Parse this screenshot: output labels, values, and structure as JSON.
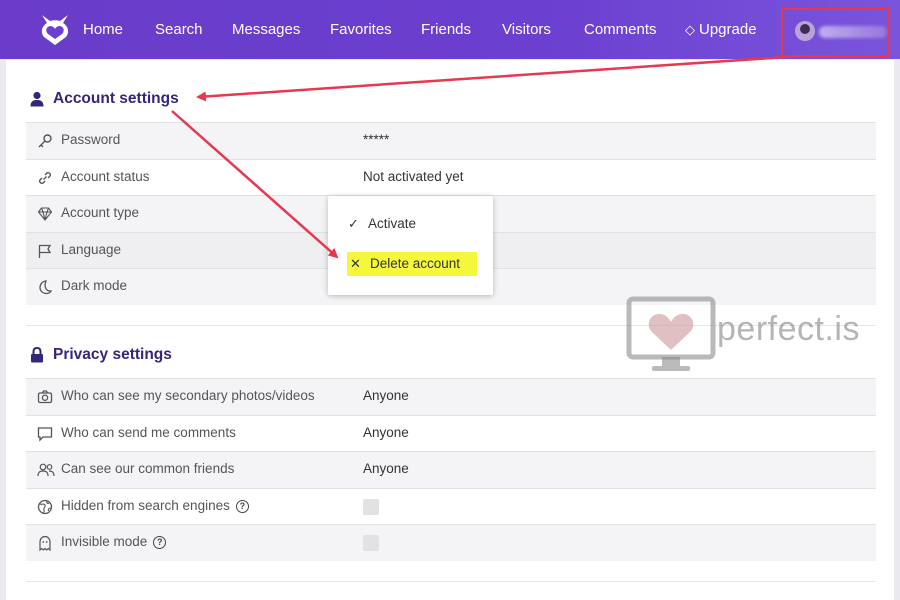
{
  "nav": {
    "items": [
      "Home",
      "Search",
      "Messages",
      "Favorites",
      "Friends",
      "Visitors",
      "Comments"
    ],
    "upgrade": "Upgrade"
  },
  "account": {
    "title": "Account settings",
    "rows": [
      {
        "label": "Password",
        "value": "*****",
        "icon": "key-icon"
      },
      {
        "label": "Account status",
        "value": "Not activated yet",
        "icon": "link-icon"
      },
      {
        "label": "Account type",
        "value": "",
        "icon": "diamond-icon"
      },
      {
        "label": "Language",
        "value": "",
        "icon": "flag-icon"
      },
      {
        "label": "Dark mode",
        "value": "",
        "icon": "moon-icon"
      }
    ]
  },
  "dropdown": {
    "activate": "Activate",
    "delete": "Delete account"
  },
  "privacy": {
    "title": "Privacy settings",
    "rows": [
      {
        "label": "Who can see my secondary photos/videos",
        "value": "Anyone",
        "icon": "camera-icon"
      },
      {
        "label": "Who can send me comments",
        "value": "Anyone",
        "icon": "comment-icon"
      },
      {
        "label": "Can see our common friends",
        "value": "Anyone",
        "icon": "users-icon"
      },
      {
        "label": "Hidden from search engines",
        "value": "",
        "icon": "globe-icon"
      },
      {
        "label": "Invisible mode",
        "value": "",
        "icon": "ghost-icon"
      }
    ]
  },
  "watermark": "perfect.is",
  "colors": {
    "nav_bg": "#6b3fd0",
    "title": "#31287a",
    "annotation": "#e5394f",
    "highlight": "#f4f73a"
  }
}
